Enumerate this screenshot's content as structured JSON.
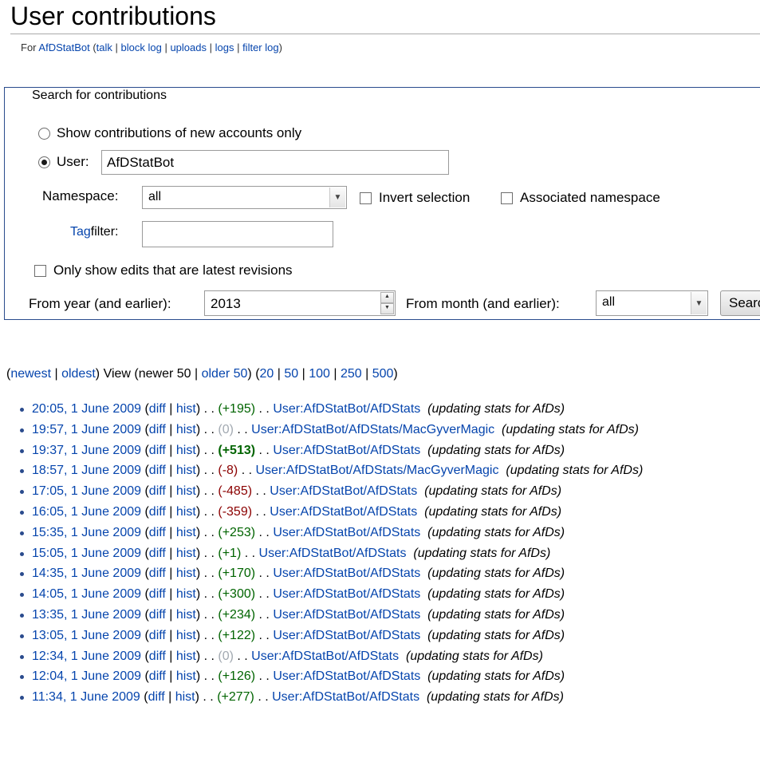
{
  "header": {
    "title": "User contributions",
    "for_prefix": "For ",
    "username": "AfDStatBot",
    "links": [
      "talk",
      "block log",
      "uploads",
      "logs",
      "filter log"
    ]
  },
  "search": {
    "legend": "Search for contributions",
    "new_accounts_label": "Show contributions of new accounts only",
    "user_label": "User:",
    "user_value": "AfDStatBot",
    "namespace_label": "Namespace:",
    "namespace_value": "all",
    "invert_label": "Invert selection",
    "associated_label": "Associated namespace",
    "tag_label": "Tag",
    "filter_label": " filter:",
    "tag_value": "",
    "latest_label": "Only show edits that are latest revisions",
    "year_label": "From year (and earlier):",
    "year_value": "2013",
    "month_label": "From month (and earlier):",
    "month_value": "all",
    "button_label": "Search"
  },
  "nav": {
    "newest": "newest",
    "oldest": "oldest",
    "view": "View (newer 50",
    "older": "older 50",
    "limits": [
      "20",
      "50",
      "100",
      "250",
      "500"
    ]
  },
  "colors": {
    "link": "#0645ad",
    "positive": "#006400",
    "negative": "#8b0000",
    "neutral": "#a2a9b1",
    "border": "#2a4b8d"
  },
  "contributions": [
    {
      "timestamp": "20:05, 1 June 2009",
      "diff": "diff",
      "hist": "hist",
      "size": "(+195)",
      "sign": "pos",
      "page": "User:AfDStatBot/AfDStats",
      "comment": "(updating stats for AfDs)"
    },
    {
      "timestamp": "19:57, 1 June 2009",
      "diff": "diff",
      "hist": "hist",
      "size": "(0)",
      "sign": "zero",
      "page": "User:AfDStatBot/AfDStats/MacGyverMagic",
      "comment": "(updating stats for AfDs)"
    },
    {
      "timestamp": "19:37, 1 June 2009",
      "diff": "diff",
      "hist": "hist",
      "size": "(+513)",
      "sign": "pos-strong",
      "page": "User:AfDStatBot/AfDStats",
      "comment": "(updating stats for AfDs)"
    },
    {
      "timestamp": "18:57, 1 June 2009",
      "diff": "diff",
      "hist": "hist",
      "size": "(-8)",
      "sign": "neg",
      "page": "User:AfDStatBot/AfDStats/MacGyverMagic",
      "comment": "(updating stats for AfDs)"
    },
    {
      "timestamp": "17:05, 1 June 2009",
      "diff": "diff",
      "hist": "hist",
      "size": "(-485)",
      "sign": "neg",
      "page": "User:AfDStatBot/AfDStats",
      "comment": "(updating stats for AfDs)"
    },
    {
      "timestamp": "16:05, 1 June 2009",
      "diff": "diff",
      "hist": "hist",
      "size": "(-359)",
      "sign": "neg",
      "page": "User:AfDStatBot/AfDStats",
      "comment": "(updating stats for AfDs)"
    },
    {
      "timestamp": "15:35, 1 June 2009",
      "diff": "diff",
      "hist": "hist",
      "size": "(+253)",
      "sign": "pos",
      "page": "User:AfDStatBot/AfDStats",
      "comment": "(updating stats for AfDs)"
    },
    {
      "timestamp": "15:05, 1 June 2009",
      "diff": "diff",
      "hist": "hist",
      "size": "(+1)",
      "sign": "pos",
      "page": "User:AfDStatBot/AfDStats",
      "comment": "(updating stats for AfDs)"
    },
    {
      "timestamp": "14:35, 1 June 2009",
      "diff": "diff",
      "hist": "hist",
      "size": "(+170)",
      "sign": "pos",
      "page": "User:AfDStatBot/AfDStats",
      "comment": "(updating stats for AfDs)"
    },
    {
      "timestamp": "14:05, 1 June 2009",
      "diff": "diff",
      "hist": "hist",
      "size": "(+300)",
      "sign": "pos",
      "page": "User:AfDStatBot/AfDStats",
      "comment": "(updating stats for AfDs)"
    },
    {
      "timestamp": "13:35, 1 June 2009",
      "diff": "diff",
      "hist": "hist",
      "size": "(+234)",
      "sign": "pos",
      "page": "User:AfDStatBot/AfDStats",
      "comment": "(updating stats for AfDs)"
    },
    {
      "timestamp": "13:05, 1 June 2009",
      "diff": "diff",
      "hist": "hist",
      "size": "(+122)",
      "sign": "pos",
      "page": "User:AfDStatBot/AfDStats",
      "comment": "(updating stats for AfDs)"
    },
    {
      "timestamp": "12:34, 1 June 2009",
      "diff": "diff",
      "hist": "hist",
      "size": "(0)",
      "sign": "zero",
      "page": "User:AfDStatBot/AfDStats",
      "comment": "(updating stats for AfDs)"
    },
    {
      "timestamp": "12:04, 1 June 2009",
      "diff": "diff",
      "hist": "hist",
      "size": "(+126)",
      "sign": "pos",
      "page": "User:AfDStatBot/AfDStats",
      "comment": "(updating stats for AfDs)"
    },
    {
      "timestamp": "11:34, 1 June 2009",
      "diff": "diff",
      "hist": "hist",
      "size": "(+277)",
      "sign": "pos",
      "page": "User:AfDStatBot/AfDStats",
      "comment": "(updating stats for AfDs)"
    }
  ]
}
